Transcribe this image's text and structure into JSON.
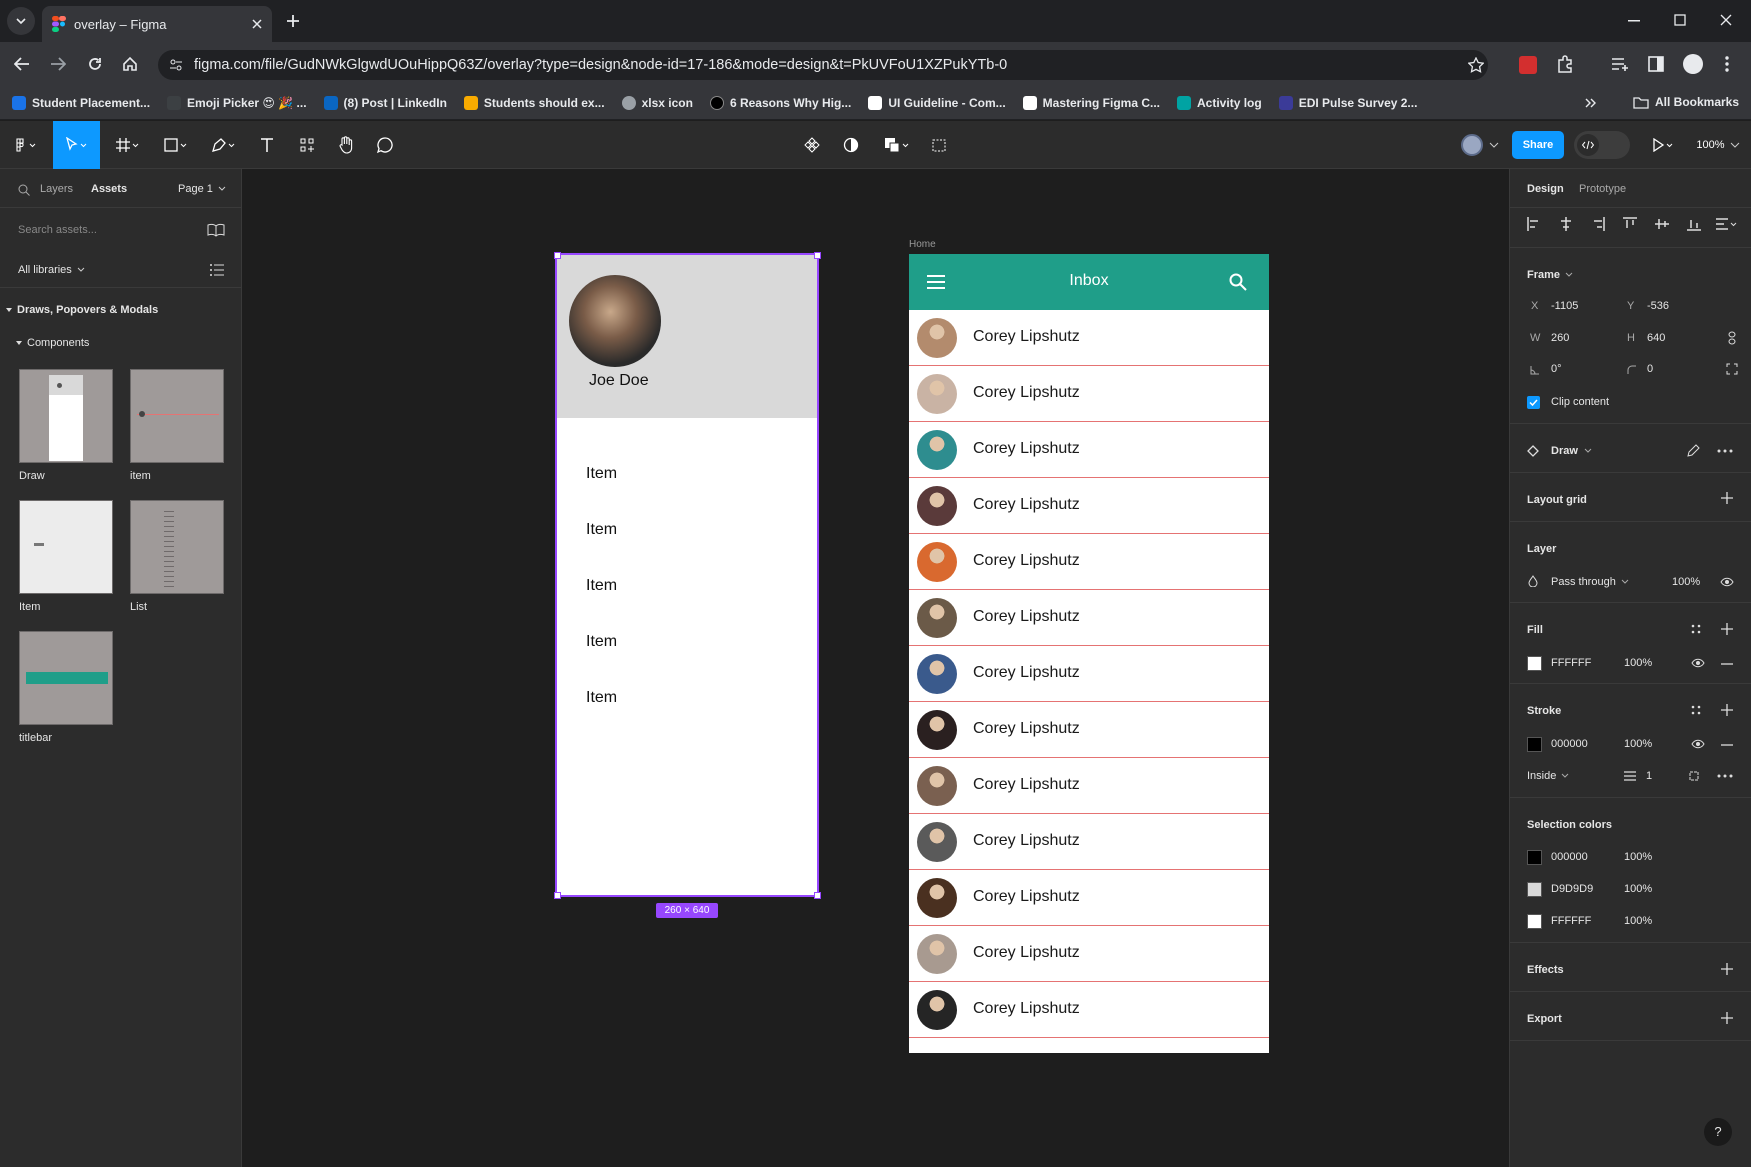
{
  "browser": {
    "tab_title": "overlay – Figma",
    "url": "figma.com/file/GudNWkGlgwdUOuHippQ63Z/overlay?type=design&node-id=17-186&mode=design&t=PkUVFoU1XZPukYTb-0",
    "bookmarks": [
      {
        "label": "Student Placement...",
        "color": "#1a73e8"
      },
      {
        "label": "Emoji Picker 😍 🎉 ...",
        "color": "#3c4043"
      },
      {
        "label": "(8) Post | LinkedIn",
        "color": "#0a66c2"
      },
      {
        "label": "Students should ex...",
        "color": "#f9ab00"
      },
      {
        "label": "xlsx icon",
        "color": "#9aa0a6"
      },
      {
        "label": "6 Reasons Why Hig...",
        "color": "#000000"
      },
      {
        "label": "UI Guideline - Com...",
        "color": "#ffffff"
      },
      {
        "label": "Mastering Figma C...",
        "color": "#ffffff"
      },
      {
        "label": "Activity log",
        "color": "#00a3a3"
      },
      {
        "label": "EDI Pulse Survey 2...",
        "color": "#3b3b98"
      }
    ],
    "all_bookmarks": "All Bookmarks"
  },
  "toolbar": {
    "share": "Share",
    "zoom": "100%",
    "accent": "#0d99ff"
  },
  "left_panel": {
    "tab_layers": "Layers",
    "tab_assets": "Assets",
    "page": "Page 1",
    "search_placeholder": "Search assets...",
    "libraries": "All libraries",
    "section": "Draws, Popovers & Modals",
    "subsection": "Components",
    "components": [
      "Draw",
      "item",
      "Item",
      "List",
      "titlebar"
    ]
  },
  "canvas": {
    "frame_label": "Home",
    "size_badge": "260 × 640",
    "drawer": {
      "name": "Joe Doe",
      "items": [
        "Item",
        "Item",
        "Item",
        "Item",
        "Item"
      ]
    },
    "inbox": {
      "title": "Inbox",
      "bar_color": "#1f9e89",
      "divider_color": "#e57373",
      "contacts": [
        {
          "name": "Corey Lipshutz",
          "tone": "#b38b6d"
        },
        {
          "name": "Corey Lipshutz",
          "tone": "#c9b3a4"
        },
        {
          "name": "Corey Lipshutz",
          "tone": "#2e8d8f"
        },
        {
          "name": "Corey Lipshutz",
          "tone": "#5a3a3a"
        },
        {
          "name": "Corey Lipshutz",
          "tone": "#d9692f"
        },
        {
          "name": "Corey Lipshutz",
          "tone": "#6b5a48"
        },
        {
          "name": "Corey Lipshutz",
          "tone": "#3a5a8c"
        },
        {
          "name": "Corey Lipshutz",
          "tone": "#2a2020"
        },
        {
          "name": "Corey Lipshutz",
          "tone": "#7a6050"
        },
        {
          "name": "Corey Lipshutz",
          "tone": "#5a5a5a"
        },
        {
          "name": "Corey Lipshutz",
          "tone": "#4a3020"
        },
        {
          "name": "Corey Lipshutz",
          "tone": "#a89a90"
        },
        {
          "name": "Corey Lipshutz",
          "tone": "#252525"
        }
      ]
    }
  },
  "right_panel": {
    "tab_design": "Design",
    "tab_prototype": "Prototype",
    "frame": {
      "label": "Frame",
      "x_label": "X",
      "x": "-1105",
      "y_label": "Y",
      "y": "-536",
      "w_label": "W",
      "w": "260",
      "h_label": "H",
      "h": "640",
      "rotation": "0°",
      "radius": "0",
      "clip": "Clip content"
    },
    "component": "Draw",
    "layout_grid": "Layout grid",
    "layer": {
      "label": "Layer",
      "mode": "Pass through",
      "opacity": "100%"
    },
    "fill": {
      "label": "Fill",
      "hex": "FFFFFF",
      "opacity": "100%",
      "color": "#FFFFFF"
    },
    "stroke": {
      "label": "Stroke",
      "hex": "000000",
      "opacity": "100%",
      "color": "#000000",
      "position": "Inside",
      "weight": "1"
    },
    "selection_colors": {
      "label": "Selection colors",
      "items": [
        {
          "hex": "000000",
          "opacity": "100%",
          "color": "#000000"
        },
        {
          "hex": "D9D9D9",
          "opacity": "100%",
          "color": "#D9D9D9"
        },
        {
          "hex": "FFFFFF",
          "opacity": "100%",
          "color": "#FFFFFF"
        }
      ]
    },
    "effects": "Effects",
    "export": "Export",
    "help": "?"
  }
}
